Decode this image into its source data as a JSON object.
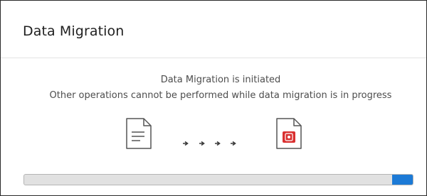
{
  "dialog": {
    "title": "Data Migration",
    "message_line1": "Data Migration is initiated",
    "message_line2": "Other operations cannot be performed while data migration is in progress"
  },
  "icons": {
    "source": "document-icon",
    "arrows": "arrow-right-icon",
    "destination": "pdf-document-icon"
  },
  "progress": {
    "indicator_fraction": 0.055,
    "indicator_position": "right end"
  },
  "colors": {
    "progress_indicator": "#1c7ad6",
    "progress_track": "#e1e1e1",
    "badge_red": "#d93030"
  }
}
